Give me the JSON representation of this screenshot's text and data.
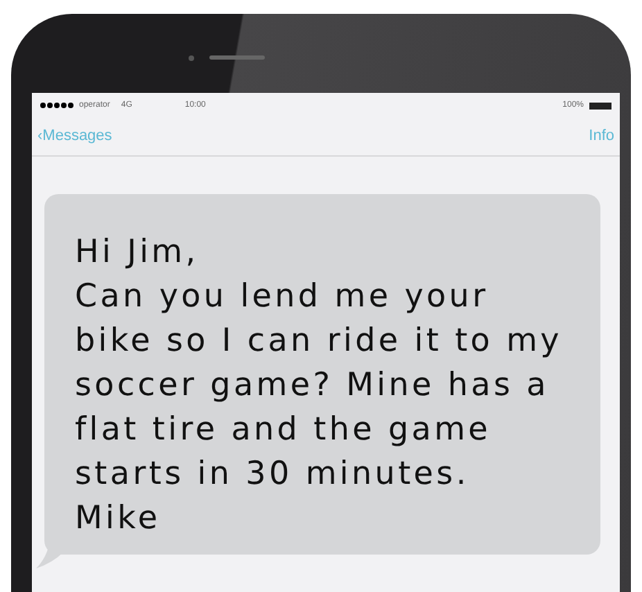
{
  "status_bar": {
    "carrier": "operator",
    "network": "4G",
    "time": "10:00",
    "battery": "100%"
  },
  "nav_bar": {
    "back_glyph": "‹",
    "back": "Messages",
    "action": "Info"
  },
  "message": {
    "paragraphs": [
      "Hi Jim,",
      "Can you lend me your bike so I can ride it to my soccer game? Mine has a flat tire and the game starts in 30 minutes.",
      "Mike"
    ]
  }
}
